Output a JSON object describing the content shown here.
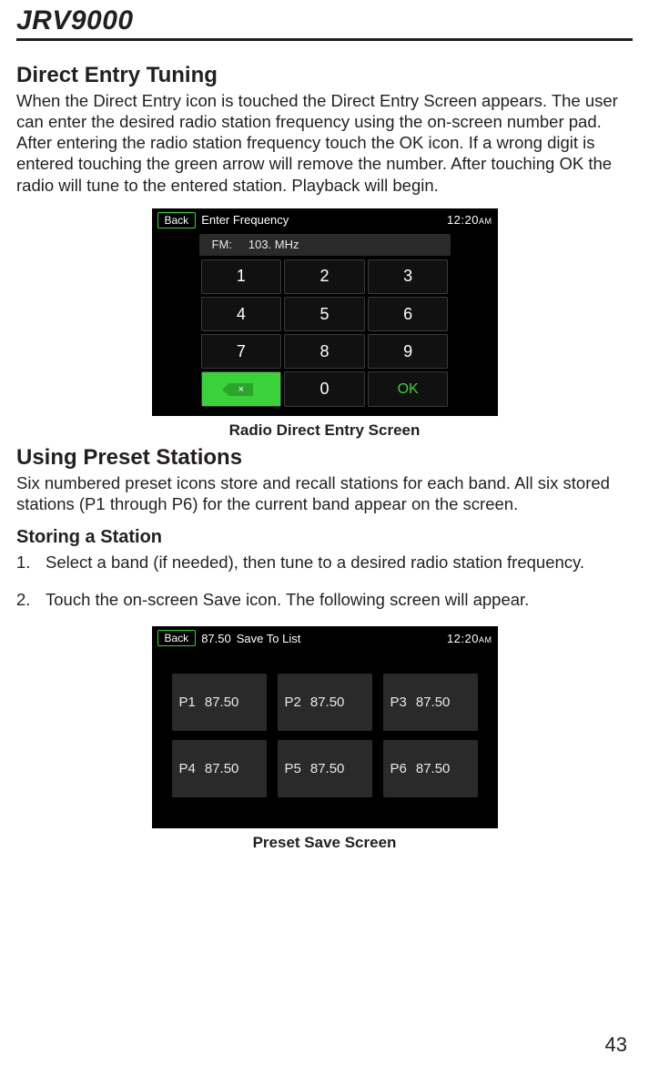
{
  "header": {
    "product": "JRV9000"
  },
  "sec1": {
    "title": "Direct Entry Tuning",
    "body": "When the Direct Entry icon is touched the Direct Entry Screen appears. The user can enter the desired radio station frequency using the on-screen number pad. After entering the radio station frequency touch the OK icon. If a wrong digit is entered touching the green arrow will remove the number. After touching OK the radio will tune to the entered station. Playback will begin."
  },
  "screen1": {
    "back": "Back",
    "title": "Enter Frequency",
    "time": "12:20",
    "ampm": "AM",
    "band": "FM:",
    "freq": "103. MHz",
    "keys": [
      "1",
      "2",
      "3",
      "4",
      "5",
      "6",
      "7",
      "8",
      "9"
    ],
    "zero": "0",
    "ok": "OK",
    "del_glyph": "×"
  },
  "caption1": "Radio Direct Entry Screen",
  "sec2": {
    "title": "Using Preset Stations",
    "body": "Six numbered preset icons store and recall stations for each band. All six stored stations (P1 through P6) for the current band appear on the screen."
  },
  "sec3": {
    "title": "Storing a Station",
    "steps": [
      " Select a band (if needed), then tune to a desired radio station frequency.",
      "Touch the on-screen Save icon. The following screen will appear."
    ]
  },
  "screen2": {
    "back": "Back",
    "freq_header": "87.50",
    "title": "Save To List",
    "time": "12:20",
    "ampm": "AM",
    "presets": [
      {
        "p": "P1",
        "v": "87.50"
      },
      {
        "p": "P2",
        "v": "87.50"
      },
      {
        "p": "P3",
        "v": "87.50"
      },
      {
        "p": "P4",
        "v": "87.50"
      },
      {
        "p": "P5",
        "v": "87.50"
      },
      {
        "p": "P6",
        "v": "87.50"
      }
    ]
  },
  "caption2": "Preset Save Screen",
  "page_number": "43"
}
